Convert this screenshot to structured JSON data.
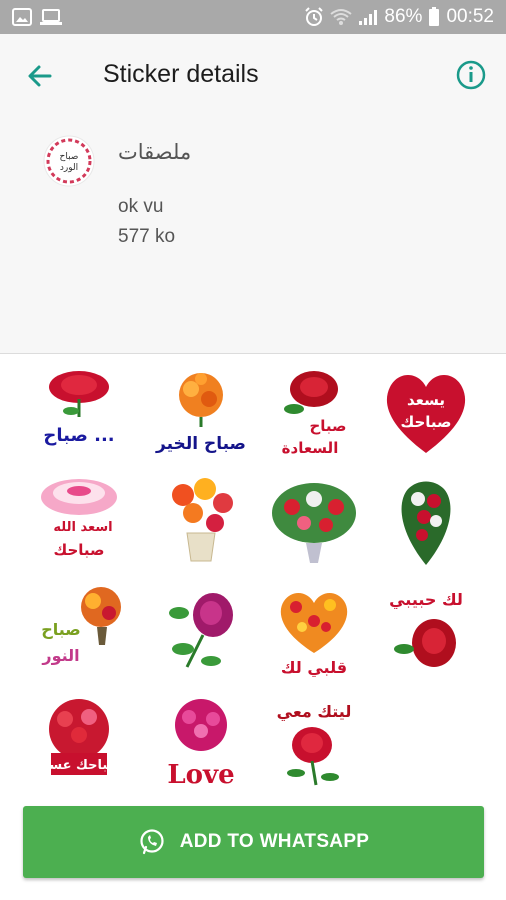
{
  "status_bar": {
    "battery": "86%",
    "time": "00:52"
  },
  "app_bar": {
    "title": "Sticker details"
  },
  "pack": {
    "name": "ملصقات",
    "publisher": "ok vu",
    "size": "577 ko",
    "icon_text": "صباح الورد"
  },
  "stickers": [
    {
      "name": "sticker-rose-sabah",
      "text": "صباح ..."
    },
    {
      "name": "sticker-orange-bouquet",
      "text": "صباح الخير"
    },
    {
      "name": "sticker-red-rose-saada",
      "text": "صباح السعادة"
    },
    {
      "name": "sticker-heart-roses",
      "text": "يسعد صباحك"
    },
    {
      "name": "sticker-pink-cake",
      "text": "اسعد الله صباحك"
    },
    {
      "name": "sticker-gerbera-vase",
      "text": ""
    },
    {
      "name": "sticker-mixed-bouquet",
      "text": ""
    },
    {
      "name": "sticker-red-white-arrangement",
      "text": ""
    },
    {
      "name": "sticker-sabah-alnoor",
      "text": "صباح النور"
    },
    {
      "name": "sticker-purple-rose",
      "text": ""
    },
    {
      "name": "sticker-heart-flowers",
      "text": "قلبي لك"
    },
    {
      "name": "sticker-lak-habibi",
      "text": "لك حبيبي"
    },
    {
      "name": "sticker-sabahak-asal",
      "text": "صباحك عسل"
    },
    {
      "name": "sticker-love-flowers",
      "text": "Love"
    },
    {
      "name": "sticker-laitak-maai",
      "text": "ليتك معي"
    }
  ],
  "action": {
    "label": "ADD TO WHATSAPP"
  },
  "colors": {
    "accent": "#1a9a8a",
    "button": "#4caf50",
    "status_bar": "#a9a9a9"
  }
}
